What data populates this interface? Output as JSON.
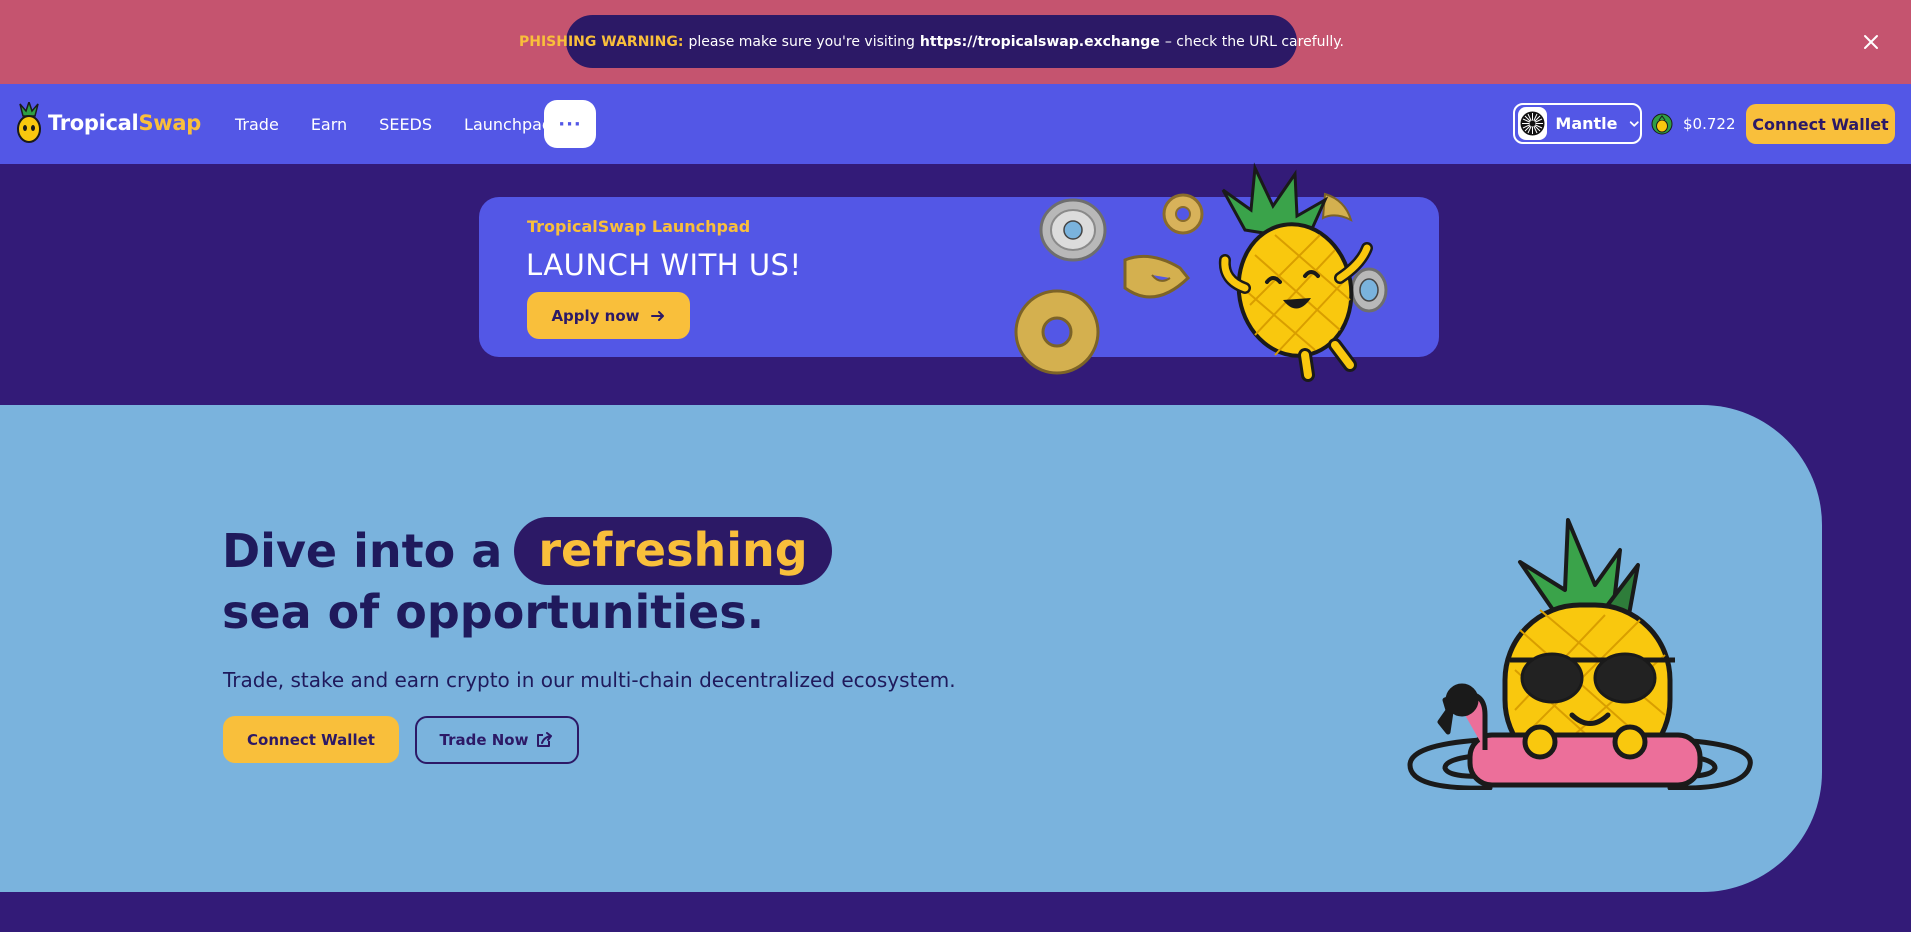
{
  "warning": {
    "label": "PHISHING WARNING:",
    "text_before": "please make sure you're visiting",
    "url": "https://tropicalswap.exchange",
    "text_after": "– check the URL carefully."
  },
  "header": {
    "logo_part1": "Tropical",
    "logo_part2": "Swap",
    "nav": [
      "Trade",
      "Earn",
      "SEEDS",
      "Launchpad"
    ],
    "more_label": "···",
    "chain": "Mantle",
    "price": "$0.722",
    "connect_label": "Connect Wallet"
  },
  "banner": {
    "subtitle": "TropicalSwap Launchpad",
    "title": "LAUNCH WITH US!",
    "apply_label": "Apply now"
  },
  "hero": {
    "line1_prefix": "Dive into a",
    "line1_highlight": "refreshing",
    "line2": "sea of opportunities.",
    "subtitle": "Trade, stake and earn crypto in our multi-chain decentralized ecosystem.",
    "connect_label": "Connect Wallet",
    "trade_label": "Trade Now"
  },
  "colors": {
    "accent_yellow": "#f9bf3b",
    "header_blue": "#5357e6",
    "warning_red": "#c5546f",
    "page_purple": "#331b78",
    "hero_blue": "#7ab3dd"
  }
}
